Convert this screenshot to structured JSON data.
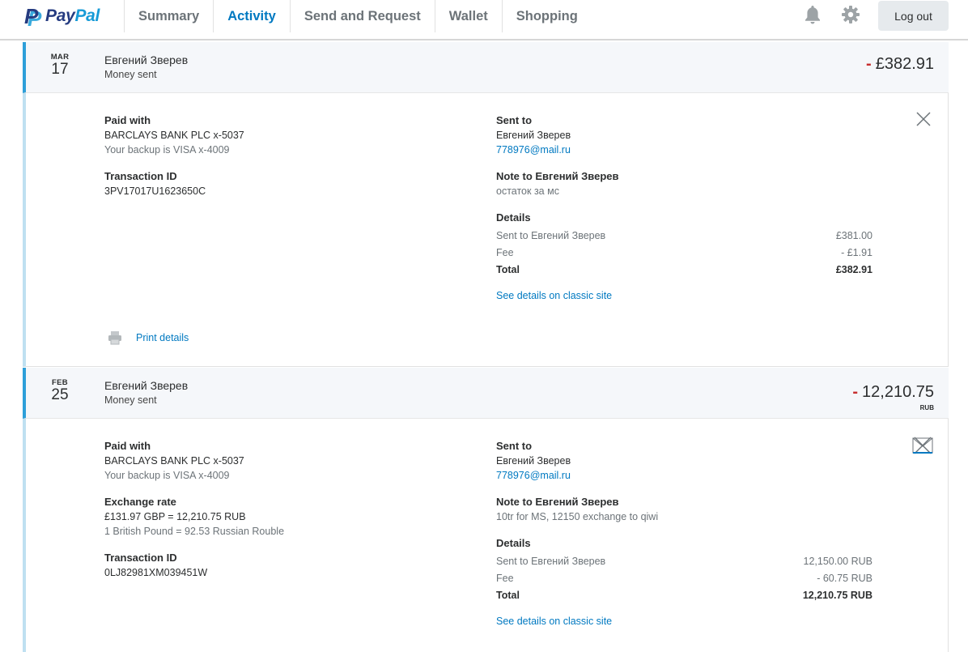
{
  "header": {
    "logo_pay": "Pay",
    "logo_pal": "Pal",
    "nav": [
      {
        "label": "Summary",
        "active": false
      },
      {
        "label": "Activity",
        "active": true
      },
      {
        "label": "Send and Request",
        "active": false
      },
      {
        "label": "Wallet",
        "active": false
      },
      {
        "label": "Shopping",
        "active": false
      }
    ],
    "icons": {
      "notifications": "bell-icon",
      "settings": "gear-icon"
    },
    "logout_label": "Log out"
  },
  "colors": {
    "accent": "#0079c1",
    "brand_dark": "#253b80",
    "brand_light": "#179bd7",
    "debit": "#c72e2e"
  },
  "transactions": [
    {
      "month": "MAR",
      "day": "17",
      "name": "Евгений Зверев",
      "type": "Money sent",
      "amount_sign": "-",
      "amount": "£382.91",
      "currency": "",
      "paid_with_label": "Paid with",
      "paid_with": "BARCLAYS BANK PLC x-5037",
      "backup": "Your backup is VISA x-4009",
      "transaction_id_label": "Transaction ID",
      "transaction_id": "3PV17017U1623650C",
      "sent_to_label": "Sent to",
      "sent_to_name": "Евгений Зверев",
      "sent_to_email": "778976@mail.ru",
      "note_label": "Note to Евгений Зверев",
      "note": "остаток за мс",
      "details_label": "Details",
      "details": [
        {
          "label": "Sent to Евгений Зверев",
          "value": "£381.00"
        },
        {
          "label": "Fee",
          "value": "- £1.91"
        },
        {
          "label": "Total",
          "value": "£382.91"
        }
      ],
      "classic_link": "See details on classic site",
      "print_label": "Print details"
    },
    {
      "month": "FEB",
      "day": "25",
      "name": "Евгений Зверев",
      "type": "Money sent",
      "amount_sign": "-",
      "amount": "12,210.75",
      "currency": "RUB",
      "paid_with_label": "Paid with",
      "paid_with": "BARCLAYS BANK PLC x-5037",
      "backup": "Your backup is VISA x-4009",
      "exchange_label": "Exchange rate",
      "exchange": "£131.97 GBP = 12,210.75 RUB",
      "exchange_rate": "1 British Pound = 92.53 Russian Rouble",
      "transaction_id_label": "Transaction ID",
      "transaction_id": "0LJ82981XM039451W",
      "sent_to_label": "Sent to",
      "sent_to_name": "Евгений Зверев",
      "sent_to_email": "778976@mail.ru",
      "note_label": "Note to Евгений Зверев",
      "note": "10tr for MS, 12150 exchange to qiwi",
      "details_label": "Details",
      "details": [
        {
          "label": "Sent to Евгений Зверев",
          "value": "12,150.00 RUB"
        },
        {
          "label": "Fee",
          "value": "- 60.75 RUB"
        },
        {
          "label": "Total",
          "value": "12,210.75 RUB"
        }
      ],
      "classic_link": "See details on classic site"
    }
  ]
}
